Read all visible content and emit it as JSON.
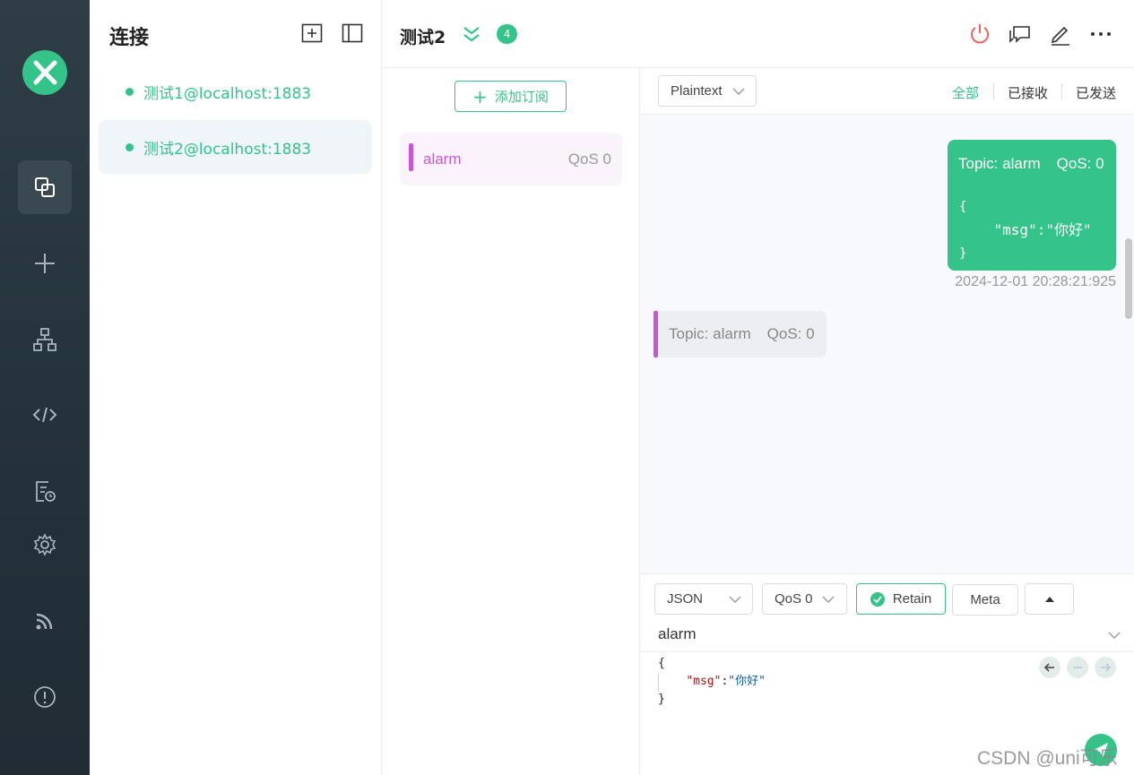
{
  "nav": {
    "items": [
      {
        "name": "connections",
        "icon": "connections-icon",
        "active": true
      },
      {
        "name": "new-connection",
        "icon": "plus-icon"
      },
      {
        "name": "topology",
        "icon": "topology-icon"
      },
      {
        "name": "script",
        "icon": "code-icon"
      },
      {
        "name": "log",
        "icon": "log-icon"
      },
      {
        "name": "settings",
        "icon": "gear-icon"
      },
      {
        "name": "feed",
        "icon": "rss-icon"
      },
      {
        "name": "about",
        "icon": "info-icon"
      }
    ]
  },
  "connections": {
    "title": "连接",
    "items": [
      {
        "label": "测试1@localhost:1883",
        "status": "connected"
      },
      {
        "label": "测试2@localhost:1883",
        "status": "connected",
        "active": true
      }
    ]
  },
  "header": {
    "title": "测试2",
    "badge": "4"
  },
  "subscriptions": {
    "add_label": "添加订阅",
    "items": [
      {
        "topic": "alarm",
        "qos": "QoS 0",
        "color": "#c756d9"
      }
    ]
  },
  "messages": {
    "format": "Plaintext",
    "tabs": [
      "全部",
      "已接收",
      "已发送"
    ],
    "active_tab": "全部",
    "list": [
      {
        "direction": "out",
        "topic": "Topic: alarm",
        "qos": "QoS: 0",
        "payload_open": "{",
        "payload_line": "    \"msg\":\"你好\"",
        "payload_close": "}",
        "time": "2024-12-01 20:28:21:925"
      },
      {
        "direction": "in",
        "topic": "Topic: alarm",
        "qos": "QoS: 0"
      }
    ]
  },
  "composer": {
    "format": "JSON",
    "qos": "QoS 0",
    "retain_label": "Retain",
    "retain_checked": true,
    "meta_label": "Meta",
    "topic": "alarm",
    "payload": {
      "open": "{",
      "key": "\"msg\"",
      "colon": ":",
      "value": "\"你好\"",
      "close": "}"
    }
  },
  "watermark": "CSDN @uni可乐",
  "colors": {
    "accent": "#34c388",
    "topic": "#c756d9",
    "nav_bg": "#2b3841"
  }
}
